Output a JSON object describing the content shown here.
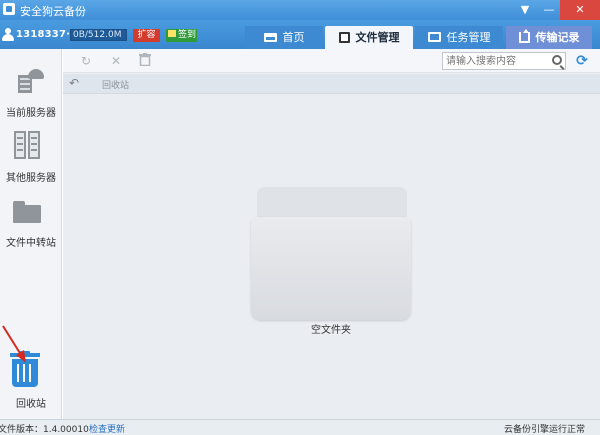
{
  "window": {
    "title": "安全狗云备份",
    "menu_glyph": "▼",
    "min_glyph": "—",
    "close_glyph": "✕"
  },
  "account": {
    "username": "1318337···",
    "quota": "0B/512.0M",
    "expand_label": "扩容",
    "signin_label": "签到"
  },
  "tabs": [
    {
      "label": "首页",
      "icon": "home-icon"
    },
    {
      "label": "文件管理",
      "icon": "file-manager-icon",
      "active": true
    },
    {
      "label": "任务管理",
      "icon": "monitor-icon"
    },
    {
      "label": "传输记录",
      "icon": "upload-icon"
    }
  ],
  "sidebar": {
    "items": [
      {
        "label": "当前服务器",
        "icon": "cloud-server-icon"
      },
      {
        "label": "其他服务器",
        "icon": "server-rack-icon"
      },
      {
        "label": "文件中转站",
        "icon": "folder-icon"
      },
      {
        "label": "回收站",
        "icon": "recycle-bin-icon",
        "active": true
      }
    ]
  },
  "toolbar": {
    "refresh_glyph": "↻",
    "delete_glyph": "✕",
    "trash_glyph": "🗑",
    "search_placeholder": "请输入搜索内容",
    "sync_glyph": "⟳"
  },
  "pathbar": {
    "back_glyph": "↶",
    "path": "回收站"
  },
  "content": {
    "empty_text": "空文件夹"
  },
  "statusbar": {
    "version": "文件版本：1.4.00010",
    "update_link": "检查更新",
    "status": "云备份引擎运行正常"
  },
  "colors": {
    "titlebar": "#4a9be0",
    "active_tab": "#f3f6fb",
    "records_tab": "#6f8fd6",
    "expand_button": "#d23b2e",
    "signin_button": "#2f9a3a",
    "recycle_icon": "#2f8bd7",
    "annotation_arrow": "#d42a1f"
  }
}
